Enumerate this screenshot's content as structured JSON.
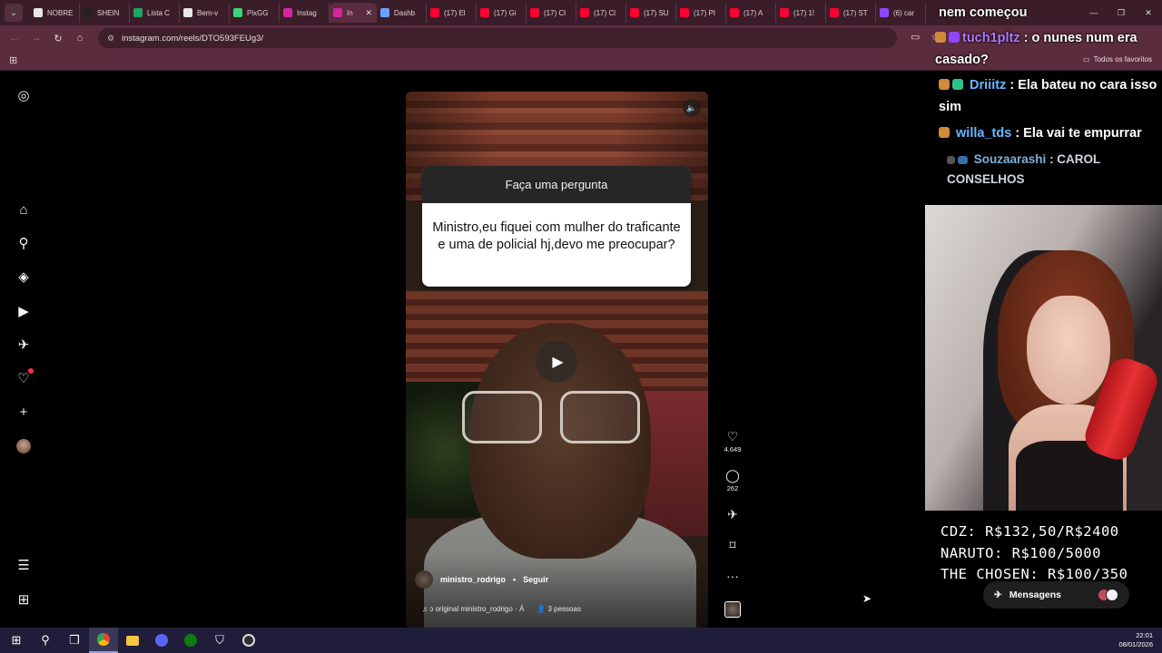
{
  "browser": {
    "tabs": [
      {
        "label": "NOBRE",
        "color": "#e8e8e8"
      },
      {
        "label": "SHEIN",
        "color": "#222222"
      },
      {
        "label": "Lista C",
        "color": "#1fa463"
      },
      {
        "label": "Bem-v",
        "color": "#e8e8e8"
      },
      {
        "label": "PixGG",
        "color": "#37d67a"
      },
      {
        "label": "Instag",
        "color": "#d6249f"
      },
      {
        "label": "In",
        "color": "#d6249f",
        "active": true
      },
      {
        "label": "Dashb",
        "color": "#6aa0ff"
      },
      {
        "label": "(17) El",
        "color": "#ff0033"
      },
      {
        "label": "(17) Gi",
        "color": "#ff0033"
      },
      {
        "label": "(17) Cl",
        "color": "#ff0033"
      },
      {
        "label": "(17) Cl",
        "color": "#ff0033"
      },
      {
        "label": "(17) SU",
        "color": "#ff0033"
      },
      {
        "label": "(17) PI",
        "color": "#ff0033"
      },
      {
        "label": "(17) A",
        "color": "#ff0033"
      },
      {
        "label": "(17) 1!",
        "color": "#ff0033"
      },
      {
        "label": "(17) ST",
        "color": "#ff0033"
      },
      {
        "label": "(6) car",
        "color": "#9146ff"
      }
    ],
    "url": "instagram.com/reels/DTO593FEUg3/",
    "bookmarks_folder": "Todos os favoritos"
  },
  "reel": {
    "question_header": "Faça uma pergunta",
    "question_text": "Ministro,eu fiquei com mulher do traficante e uma de policial hj,devo me preocupar?",
    "author": "ministro_rodrigo",
    "separator": "•",
    "follow": "Seguir",
    "audio": "ɔ original  ministro_rodrigo · Á",
    "people": "3 pessoas",
    "likes": "4.649",
    "comments": "262"
  },
  "chat": [
    {
      "user": "",
      "text": "nem começou"
    },
    {
      "user": "tuch1pltz",
      "text": ": o nunes num era casado?"
    },
    {
      "user": "Driiitz",
      "text": ": Ela bateu no cara isso sim"
    },
    {
      "user": "willa_tds",
      "text": ": Ela vai te empurrar"
    },
    {
      "user": "Souzaarashi",
      "text": ": CAROL CONSELHOS"
    }
  ],
  "goals": [
    "CDZ: R$132,50/R$2400",
    "NARUTO: R$100/5000",
    "THE CHOSEN: R$100/350"
  ],
  "messages_label": "Mensagens",
  "taskbar": {
    "time": "22:01",
    "date": "08/01/2026"
  }
}
